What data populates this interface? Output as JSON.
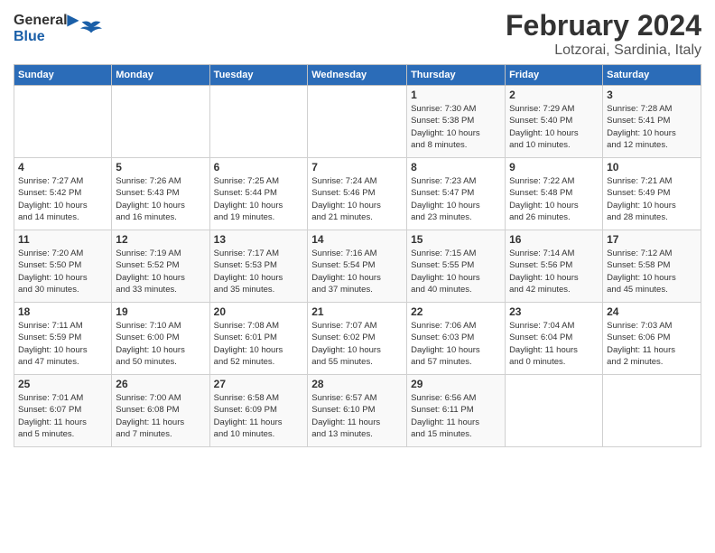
{
  "header": {
    "logo": "GeneralBlue",
    "title": "February 2024",
    "subtitle": "Lotzorai, Sardinia, Italy"
  },
  "columns": [
    "Sunday",
    "Monday",
    "Tuesday",
    "Wednesday",
    "Thursday",
    "Friday",
    "Saturday"
  ],
  "weeks": [
    [
      {
        "day": "",
        "info": ""
      },
      {
        "day": "",
        "info": ""
      },
      {
        "day": "",
        "info": ""
      },
      {
        "day": "",
        "info": ""
      },
      {
        "day": "1",
        "info": "Sunrise: 7:30 AM\nSunset: 5:38 PM\nDaylight: 10 hours\nand 8 minutes."
      },
      {
        "day": "2",
        "info": "Sunrise: 7:29 AM\nSunset: 5:40 PM\nDaylight: 10 hours\nand 10 minutes."
      },
      {
        "day": "3",
        "info": "Sunrise: 7:28 AM\nSunset: 5:41 PM\nDaylight: 10 hours\nand 12 minutes."
      }
    ],
    [
      {
        "day": "4",
        "info": "Sunrise: 7:27 AM\nSunset: 5:42 PM\nDaylight: 10 hours\nand 14 minutes."
      },
      {
        "day": "5",
        "info": "Sunrise: 7:26 AM\nSunset: 5:43 PM\nDaylight: 10 hours\nand 16 minutes."
      },
      {
        "day": "6",
        "info": "Sunrise: 7:25 AM\nSunset: 5:44 PM\nDaylight: 10 hours\nand 19 minutes."
      },
      {
        "day": "7",
        "info": "Sunrise: 7:24 AM\nSunset: 5:46 PM\nDaylight: 10 hours\nand 21 minutes."
      },
      {
        "day": "8",
        "info": "Sunrise: 7:23 AM\nSunset: 5:47 PM\nDaylight: 10 hours\nand 23 minutes."
      },
      {
        "day": "9",
        "info": "Sunrise: 7:22 AM\nSunset: 5:48 PM\nDaylight: 10 hours\nand 26 minutes."
      },
      {
        "day": "10",
        "info": "Sunrise: 7:21 AM\nSunset: 5:49 PM\nDaylight: 10 hours\nand 28 minutes."
      }
    ],
    [
      {
        "day": "11",
        "info": "Sunrise: 7:20 AM\nSunset: 5:50 PM\nDaylight: 10 hours\nand 30 minutes."
      },
      {
        "day": "12",
        "info": "Sunrise: 7:19 AM\nSunset: 5:52 PM\nDaylight: 10 hours\nand 33 minutes."
      },
      {
        "day": "13",
        "info": "Sunrise: 7:17 AM\nSunset: 5:53 PM\nDaylight: 10 hours\nand 35 minutes."
      },
      {
        "day": "14",
        "info": "Sunrise: 7:16 AM\nSunset: 5:54 PM\nDaylight: 10 hours\nand 37 minutes."
      },
      {
        "day": "15",
        "info": "Sunrise: 7:15 AM\nSunset: 5:55 PM\nDaylight: 10 hours\nand 40 minutes."
      },
      {
        "day": "16",
        "info": "Sunrise: 7:14 AM\nSunset: 5:56 PM\nDaylight: 10 hours\nand 42 minutes."
      },
      {
        "day": "17",
        "info": "Sunrise: 7:12 AM\nSunset: 5:58 PM\nDaylight: 10 hours\nand 45 minutes."
      }
    ],
    [
      {
        "day": "18",
        "info": "Sunrise: 7:11 AM\nSunset: 5:59 PM\nDaylight: 10 hours\nand 47 minutes."
      },
      {
        "day": "19",
        "info": "Sunrise: 7:10 AM\nSunset: 6:00 PM\nDaylight: 10 hours\nand 50 minutes."
      },
      {
        "day": "20",
        "info": "Sunrise: 7:08 AM\nSunset: 6:01 PM\nDaylight: 10 hours\nand 52 minutes."
      },
      {
        "day": "21",
        "info": "Sunrise: 7:07 AM\nSunset: 6:02 PM\nDaylight: 10 hours\nand 55 minutes."
      },
      {
        "day": "22",
        "info": "Sunrise: 7:06 AM\nSunset: 6:03 PM\nDaylight: 10 hours\nand 57 minutes."
      },
      {
        "day": "23",
        "info": "Sunrise: 7:04 AM\nSunset: 6:04 PM\nDaylight: 11 hours\nand 0 minutes."
      },
      {
        "day": "24",
        "info": "Sunrise: 7:03 AM\nSunset: 6:06 PM\nDaylight: 11 hours\nand 2 minutes."
      }
    ],
    [
      {
        "day": "25",
        "info": "Sunrise: 7:01 AM\nSunset: 6:07 PM\nDaylight: 11 hours\nand 5 minutes."
      },
      {
        "day": "26",
        "info": "Sunrise: 7:00 AM\nSunset: 6:08 PM\nDaylight: 11 hours\nand 7 minutes."
      },
      {
        "day": "27",
        "info": "Sunrise: 6:58 AM\nSunset: 6:09 PM\nDaylight: 11 hours\nand 10 minutes."
      },
      {
        "day": "28",
        "info": "Sunrise: 6:57 AM\nSunset: 6:10 PM\nDaylight: 11 hours\nand 13 minutes."
      },
      {
        "day": "29",
        "info": "Sunrise: 6:56 AM\nSunset: 6:11 PM\nDaylight: 11 hours\nand 15 minutes."
      },
      {
        "day": "",
        "info": ""
      },
      {
        "day": "",
        "info": ""
      }
    ]
  ]
}
